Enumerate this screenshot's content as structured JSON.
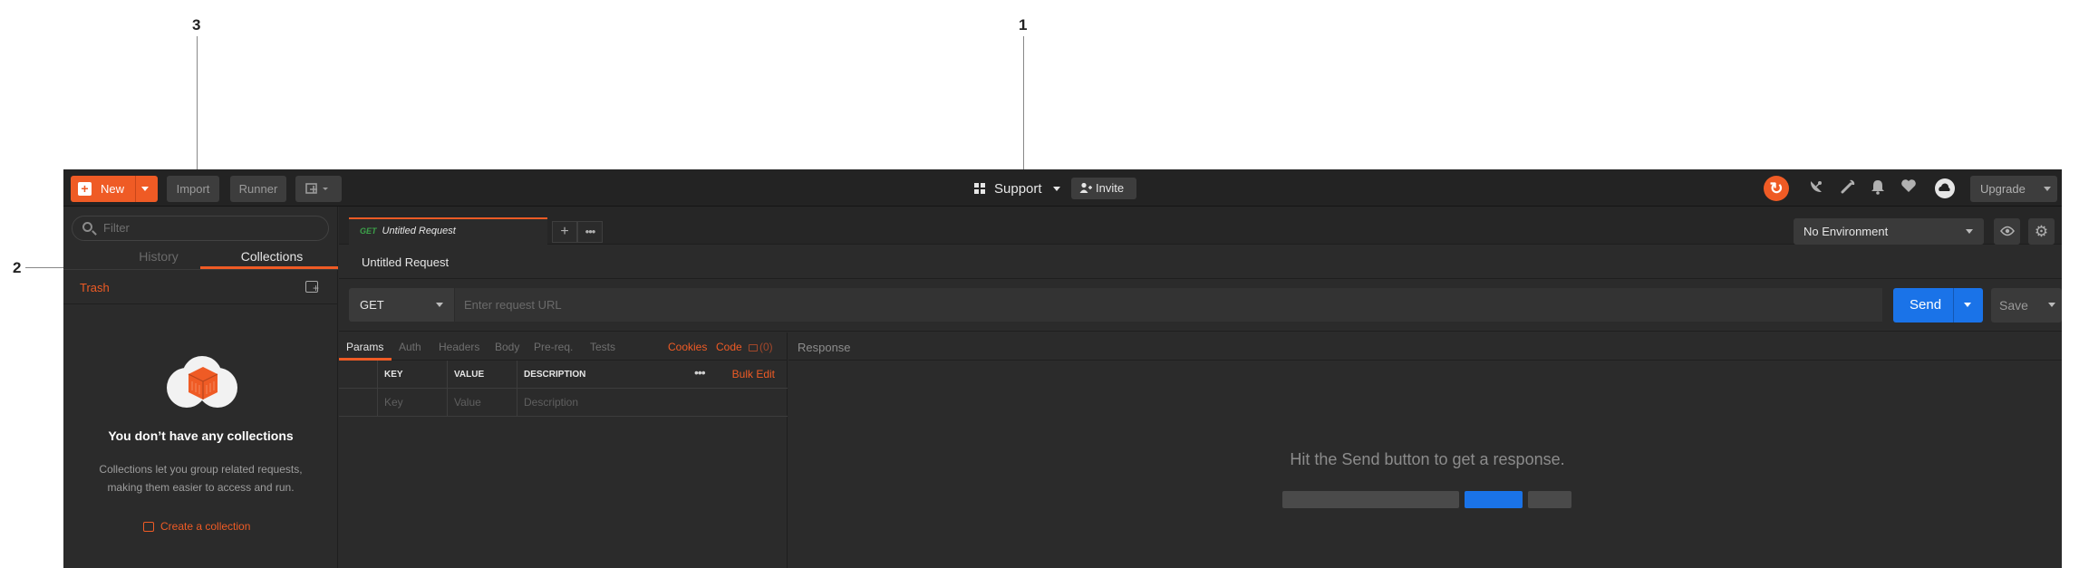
{
  "annotations": [
    "1",
    "2",
    "3"
  ],
  "header": {
    "new_label": "New",
    "import_label": "Import",
    "runner_label": "Runner",
    "workspace_label": "Support",
    "invite_label": "Invite",
    "upgrade_label": "Upgrade",
    "icons": [
      "new-window-icon",
      "sync-icon",
      "satellite-icon",
      "wrench-icon",
      "bell-icon",
      "heart-icon",
      "cloud-icon"
    ]
  },
  "sidebar": {
    "filter_placeholder": "Filter",
    "tabs": [
      "History",
      "Collections"
    ],
    "active_tab": "Collections",
    "trash_label": "Trash",
    "empty_title": "You don’t have any collections",
    "empty_desc": "Collections let you group related requests, making them easier to access and run.",
    "create_label": "Create a collection"
  },
  "request": {
    "tab_method": "GET",
    "tab_name": "Untitled Request",
    "title": "Untitled Request",
    "method": "GET",
    "url_placeholder": "Enter request URL",
    "send_label": "Send",
    "save_label": "Save",
    "environment": "No Environment",
    "tabs": [
      "Params",
      "Auth",
      "Headers",
      "Body",
      "Pre-req.",
      "Tests"
    ],
    "active_tab": "Params",
    "right_links": [
      "Cookies",
      "Code"
    ],
    "comments": "(0)",
    "params_table": {
      "headers": [
        "KEY",
        "VALUE",
        "DESCRIPTION"
      ],
      "bulk_edit": "Bulk Edit",
      "placeholders": [
        "Key",
        "Value",
        "Description"
      ]
    }
  },
  "response": {
    "label": "Response",
    "message": "Hit the Send button to get a response."
  },
  "colors": {
    "accent": "#ef5b25",
    "send_blue": "#1a73e8",
    "background": "#2b2b2b"
  }
}
